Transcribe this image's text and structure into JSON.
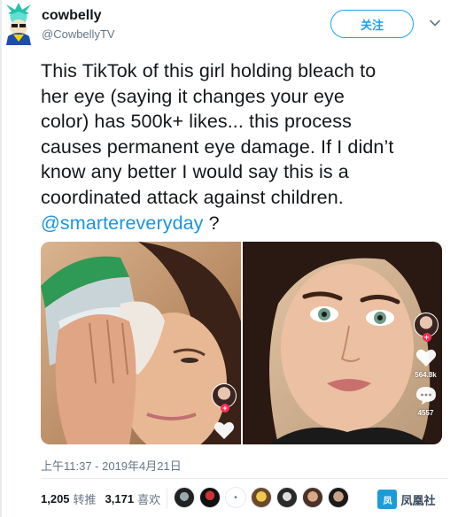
{
  "author": {
    "display_name": "cowbelly",
    "handle": "@CowbellyTV"
  },
  "follow_label": "关注",
  "tweet": {
    "text_lines": [
      "This TikTok of this girl holding bleach to",
      "her eye (saying it changes your eye",
      "color) has 500k+ likes... this process",
      "causes permanent eye damage. If I didn’t",
      "know any better I would say this is a",
      "coordinated attack against children."
    ],
    "mention": "@smartereveryday",
    "mention_suffix": " ?"
  },
  "media": {
    "right_photo": {
      "like_count": "564.8k",
      "comment_count": "4557"
    },
    "left_photo": {
      "plus_symbol": "+"
    },
    "right_plus_symbol": "+"
  },
  "timestamp": "上午11:37 - 2019年4月21日",
  "stats": {
    "retweets_count": "1,205",
    "retweets_label": "转推",
    "likes_count": "3,171",
    "likes_label": "喜欢"
  },
  "watermark": {
    "box_text": "凤",
    "text": "凤凰社"
  },
  "colors": {
    "accent": "#1da1f2",
    "mention": "#1b95e0",
    "muted": "#657786",
    "tiktok_red": "#fe2c55"
  },
  "icons": {
    "chevron": "chevron-down-icon",
    "heart": "heart-icon",
    "comment": "comment-icon"
  }
}
